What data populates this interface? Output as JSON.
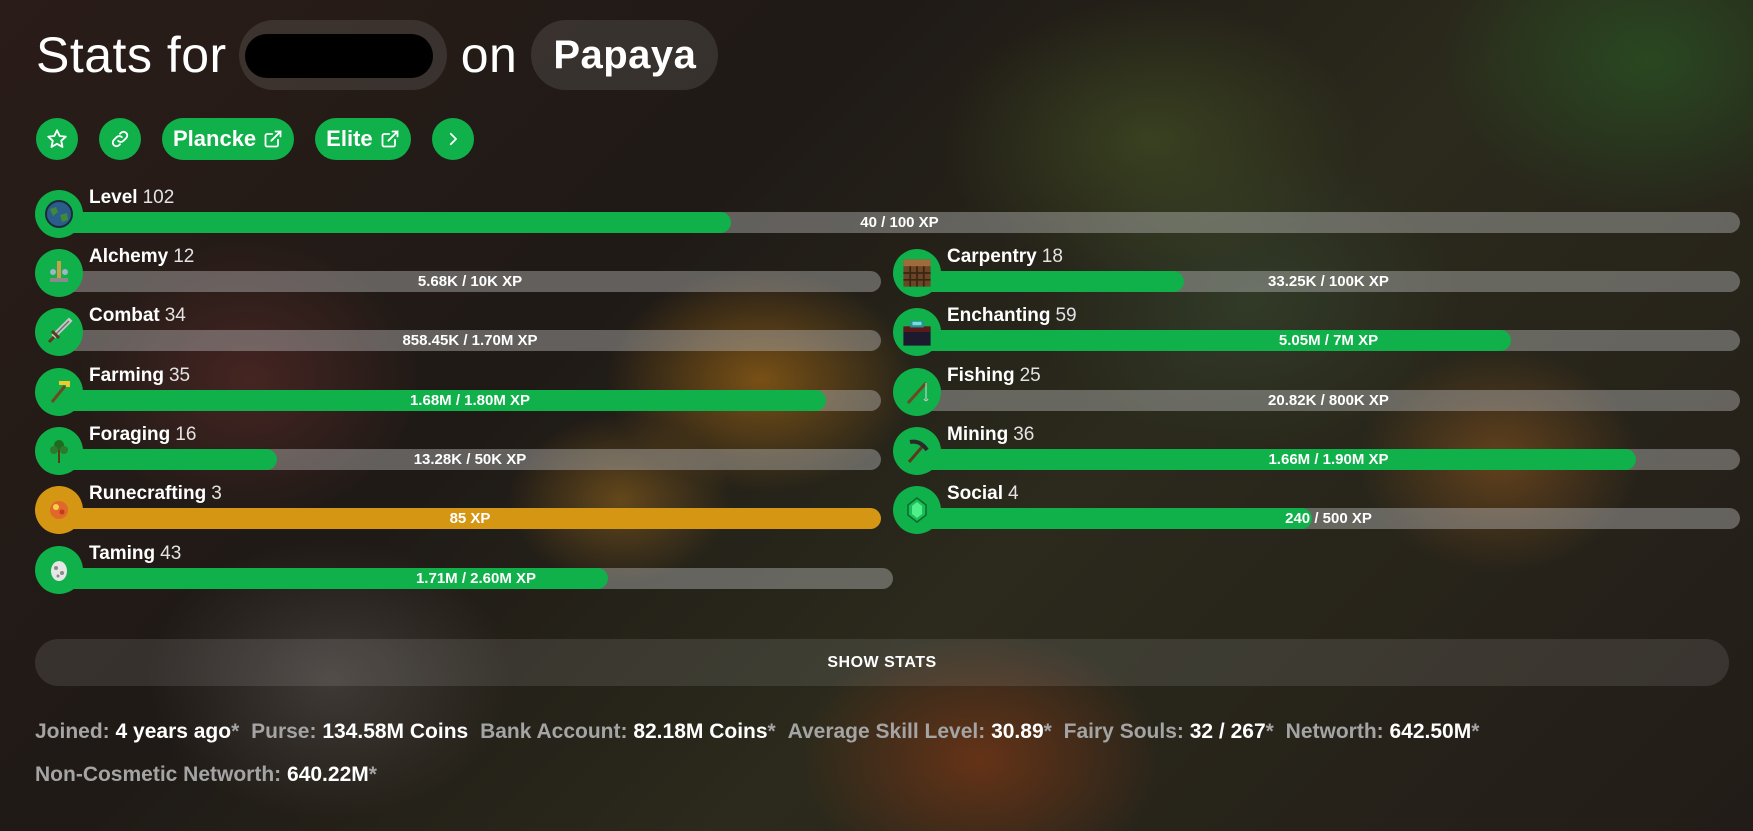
{
  "header": {
    "prefix": "Stats for",
    "connector": "on",
    "profile": "Papaya"
  },
  "buttons": {
    "favorite_icon": "star-icon",
    "link_icon": "link-icon",
    "plancke": "Plancke",
    "elite": "Elite",
    "more_icon": "chevron-right-icon"
  },
  "level": {
    "name": "Level",
    "level": "102",
    "xp": "40 / 100 XP",
    "progress": 0.4
  },
  "skills": [
    {
      "name": "Alchemy",
      "level": "12",
      "xp": "5.68K / 10K XP",
      "progress": 0.0,
      "icon": "brewing-stand-icon"
    },
    {
      "name": "Carpentry",
      "level": "18",
      "xp": "33.25K / 100K XP",
      "progress": 0.325,
      "icon": "crafting-table-icon"
    },
    {
      "name": "Combat",
      "level": "34",
      "xp": "858.45K / 1.70M XP",
      "progress": 0.0,
      "icon": "sword-icon"
    },
    {
      "name": "Enchanting",
      "level": "59",
      "xp": "5.05M / 7M XP",
      "progress": 0.722,
      "icon": "enchanting-table-icon"
    },
    {
      "name": "Farming",
      "level": "35",
      "xp": "1.68M / 1.80M XP",
      "progress": 0.933,
      "icon": "golden-hoe-icon"
    },
    {
      "name": "Fishing",
      "level": "25",
      "xp": "20.82K / 800K XP",
      "progress": 0.0,
      "icon": "fishing-rod-icon"
    },
    {
      "name": "Foraging",
      "level": "16",
      "xp": "13.28K / 50K XP",
      "progress": 0.265,
      "icon": "sapling-icon"
    },
    {
      "name": "Mining",
      "level": "36",
      "xp": "1.66M / 1.90M XP",
      "progress": 0.874,
      "icon": "pickaxe-icon"
    },
    {
      "name": "Runecrafting",
      "level": "3",
      "xp": "85 XP",
      "progress": 1.0,
      "icon": "magma-cream-icon",
      "accent": "#d59614"
    },
    {
      "name": "Social",
      "level": "4",
      "xp": "240 / 500 XP",
      "progress": 0.48,
      "icon": "emerald-icon"
    },
    {
      "name": "Taming",
      "level": "43",
      "xp": "1.71M / 2.60M XP",
      "progress": 0.658,
      "icon": "spawn-egg-icon"
    }
  ],
  "show_stats": "SHOW STATS",
  "stats": [
    {
      "key": "Joined:",
      "value": "4 years ago",
      "asterisk": "*"
    },
    {
      "key": "Purse:",
      "value": "134.58M Coins",
      "asterisk": ""
    },
    {
      "key": "Bank Account:",
      "value": "82.18M Coins",
      "asterisk": "*"
    },
    {
      "key": "Average Skill Level:",
      "value": "30.89",
      "asterisk": "*"
    },
    {
      "key": "Fairy Souls:",
      "value": "32 / 267",
      "asterisk": "*"
    },
    {
      "key": "Networth:",
      "value": "642.50M",
      "asterisk": "*"
    },
    {
      "key": "Non-Cosmetic Networth:",
      "value": "640.22M",
      "asterisk": "*"
    }
  ],
  "colors": {
    "accent": "#10b04a",
    "gold": "#d59614"
  }
}
